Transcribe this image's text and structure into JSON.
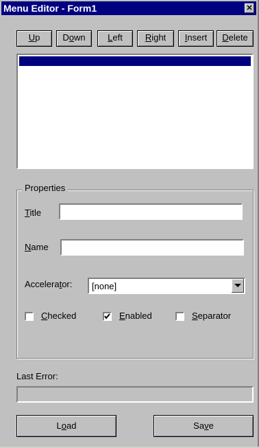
{
  "window": {
    "title": "Menu Editor - Form1",
    "close_glyph": "✕"
  },
  "toolbar": {
    "up": {
      "pre": "",
      "key": "U",
      "post": "p"
    },
    "down": {
      "pre": "D",
      "key": "o",
      "post": "wn"
    },
    "left": {
      "pre": "",
      "key": "L",
      "post": "eft"
    },
    "right": {
      "pre": "",
      "key": "R",
      "post": "ight"
    },
    "insert": {
      "pre": "",
      "key": "I",
      "post": "nsert"
    },
    "delete": {
      "pre": "",
      "key": "D",
      "post": "elete"
    }
  },
  "properties": {
    "group_label": "Properties",
    "title": {
      "key": "T",
      "post": "itle",
      "value": ""
    },
    "name": {
      "key": "N",
      "post": "ame",
      "value": ""
    },
    "accelerator": {
      "pre": "Accelera",
      "key": "t",
      "post": "or:",
      "value": "[none]"
    },
    "checked": {
      "key": "C",
      "post": "hecked",
      "checked": false
    },
    "enabled": {
      "key": "E",
      "post": "nabled",
      "checked": true
    },
    "separator": {
      "key": "S",
      "post": "eparator",
      "checked": false
    }
  },
  "last_error": {
    "label": "Last Error:",
    "value": ""
  },
  "footer": {
    "load": {
      "pre": "L",
      "key": "o",
      "post": "ad"
    },
    "save": {
      "pre": "Sa",
      "key": "v",
      "post": "e"
    }
  }
}
